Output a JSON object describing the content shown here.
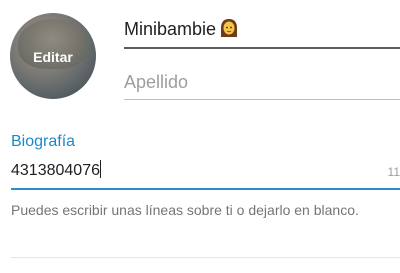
{
  "avatar": {
    "edit_label": "Editar"
  },
  "profile": {
    "first_name": "Minibambie",
    "first_name_emoji": "woman-emoji-icon",
    "last_name_placeholder": "Apellido"
  },
  "bio": {
    "label": "Biografía",
    "value": "4313804076",
    "char_counter": "11",
    "helper_text": "Puedes escribir unas líneas sobre ti o dejarlo en blanco."
  },
  "colors": {
    "accent": "#1e88c7",
    "text": "#212121",
    "hint": "#9e9e9e"
  }
}
